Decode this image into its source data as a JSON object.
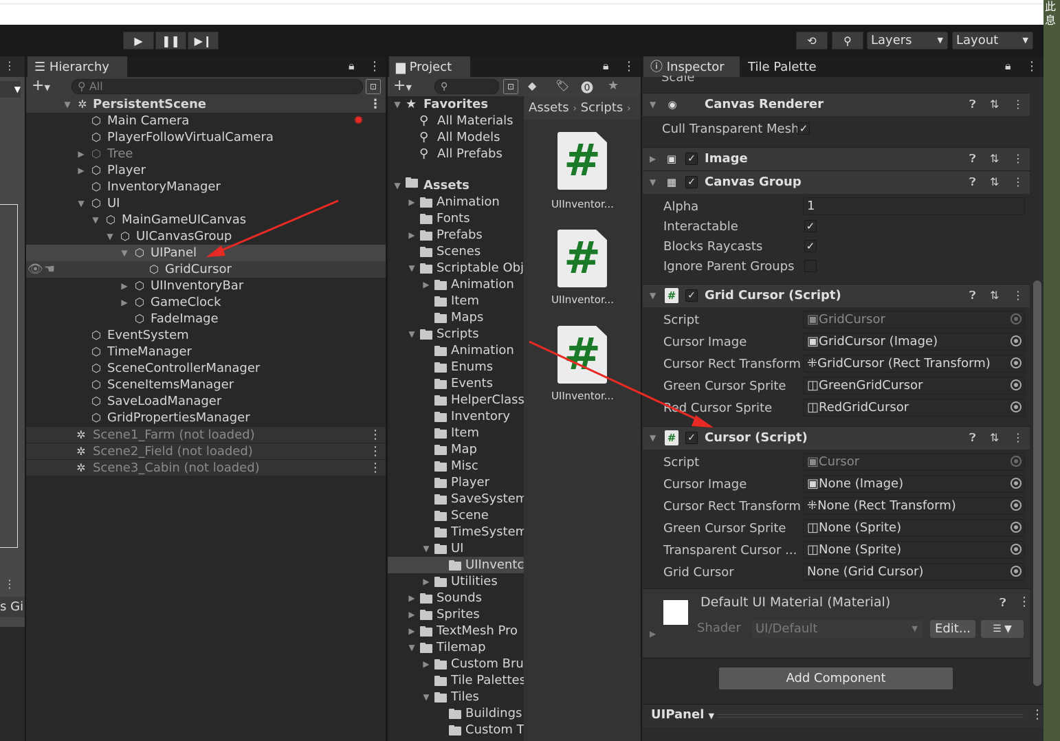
{
  "toolbar": {
    "play_icon": "play-icon",
    "pause_icon": "pause-icon",
    "step_icon": "step-icon",
    "history_icon": "history-icon",
    "search_icon": "search-icon",
    "layers_label": "Layers",
    "layout_label": "Layout"
  },
  "right_edge_text": [
    "此",
    "息"
  ],
  "left_strip": {
    "label_s": "s",
    "label_gi": "Gi"
  },
  "hierarchy": {
    "tab": "Hierarchy",
    "search_placeholder": "All",
    "scene": "PersistentScene",
    "items": [
      {
        "label": "Main Camera"
      },
      {
        "label": "PlayerFollowVirtualCamera"
      },
      {
        "label": "Tree"
      },
      {
        "label": "Player"
      },
      {
        "label": "InventoryManager"
      },
      {
        "label": "UI"
      },
      {
        "label": "MainGameUICanvas"
      },
      {
        "label": "UICanvasGroup"
      },
      {
        "label": "UIPanel"
      },
      {
        "label": "GridCursor"
      },
      {
        "label": "UIInventoryBar"
      },
      {
        "label": "GameClock"
      },
      {
        "label": "FadeImage"
      },
      {
        "label": "EventSystem"
      },
      {
        "label": "TimeManager"
      },
      {
        "label": "SceneControllerManager"
      },
      {
        "label": "SceneItemsManager"
      },
      {
        "label": "SaveLoadManager"
      },
      {
        "label": "GridPropertiesManager"
      }
    ],
    "unloaded": [
      "Scene1_Farm (not loaded)",
      "Scene2_Field (not loaded)",
      "Scene3_Cabin (not loaded)"
    ]
  },
  "project": {
    "tab": "Project",
    "favorites": "Favorites",
    "fav_items": [
      "All Materials",
      "All Models",
      "All Prefabs"
    ],
    "assets": "Assets",
    "tree": [
      "Animation",
      "Fonts",
      "Prefabs",
      "Scenes",
      "Scriptable Obj",
      "Animation",
      "Item",
      "Maps",
      "Scripts",
      "Animation",
      "Enums",
      "Events",
      "HelperClass",
      "Inventory",
      "Item",
      "Map",
      "Misc",
      "Player",
      "SaveSystem",
      "Scene",
      "TimeSystem",
      "UI",
      "UIInventc",
      "Utilities",
      "Sounds",
      "Sprites",
      "TextMesh Pro",
      "Tilemap",
      "Custom Brus",
      "Tile Palettes",
      "Tiles",
      "Buildings",
      "Custom T"
    ],
    "breadcrumb": [
      "Assets",
      "Scripts"
    ],
    "files": [
      "UIInventor...",
      "UIInventor...",
      "UIInventor..."
    ]
  },
  "inspector": {
    "tab": "Inspector",
    "tab2": "Tile Palette",
    "clipped_label": "Scale",
    "canvas_renderer": {
      "title": "Canvas Renderer",
      "cull": "Cull Transparent Mesh"
    },
    "image": {
      "title": "Image"
    },
    "canvas_group": {
      "title": "Canvas Group",
      "alpha_label": "Alpha",
      "alpha_value": "1",
      "interactable": "Interactable",
      "blocks": "Blocks Raycasts",
      "ignore": "Ignore Parent Groups"
    },
    "grid_cursor": {
      "title": "Grid Cursor (Script)",
      "rows": [
        {
          "label": "Script",
          "value": "GridCursor"
        },
        {
          "label": "Cursor Image",
          "value": "GridCursor (Image)"
        },
        {
          "label": "Cursor Rect Transform",
          "value": "GridCursor (Rect Transform)"
        },
        {
          "label": "Green Cursor Sprite",
          "value": "GreenGridCursor"
        },
        {
          "label": "Red Cursor Sprite",
          "value": "RedGridCursor"
        }
      ]
    },
    "cursor": {
      "title": "Cursor (Script)",
      "rows": [
        {
          "label": "Script",
          "value": "Cursor"
        },
        {
          "label": "Cursor Image",
          "value": "None (Image)"
        },
        {
          "label": "Cursor Rect Transform",
          "value": "None (Rect Transform)"
        },
        {
          "label": "Green Cursor Sprite",
          "value": "None (Sprite)"
        },
        {
          "label": "Transparent Cursor ...",
          "value": "None (Sprite)"
        },
        {
          "label": "Grid Cursor",
          "value": "None (Grid Cursor)"
        }
      ]
    },
    "material": {
      "title": "Default UI Material (Material)",
      "shader_label": "Shader",
      "shader_value": "UI/Default",
      "edit": "Edit..."
    },
    "add_component": "Add Component",
    "footer": "UIPanel"
  },
  "colors": {
    "accent_red": "#e82a24",
    "script_green": "#1b7a28",
    "selection": "#464646"
  }
}
